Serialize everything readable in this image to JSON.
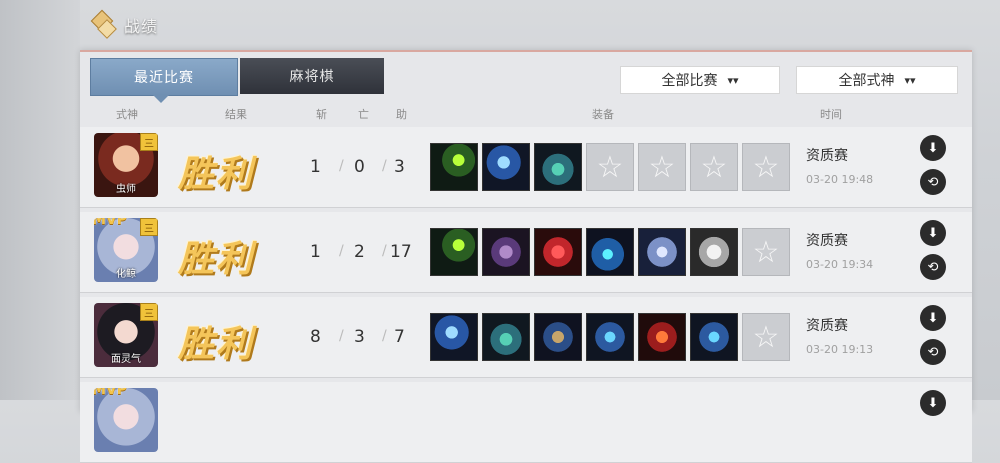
{
  "header": {
    "title": "战绩",
    "icon": "diamond-logo-icon"
  },
  "tabs": [
    {
      "label": "最近比赛",
      "active": true
    },
    {
      "label": "麻将棋",
      "active": false
    }
  ],
  "filters": [
    {
      "label": "全部比赛",
      "icon": "double-chevron-down-icon"
    },
    {
      "label": "全部式神",
      "icon": "double-chevron-down-icon"
    }
  ],
  "columns": {
    "shikigami": "式神",
    "result": "结果",
    "kill": "斩",
    "death": "亡",
    "assist": "助",
    "equipment": "装备",
    "time": "时间"
  },
  "rows": [
    {
      "avatar_name": "虫师",
      "mvp": "",
      "grade": "三",
      "result": "胜利",
      "kill": "1",
      "death": "0",
      "assist": "3",
      "mode": "资质赛",
      "time": "03-20 19:48",
      "equipment": [
        "eq-green",
        "eq-blue",
        "eq-box",
        "empty",
        "empty",
        "empty",
        "empty"
      ]
    },
    {
      "avatar_name": "化鲸",
      "mvp": "MVP",
      "grade": "三",
      "result": "胜利",
      "kill": "1",
      "death": "2",
      "assist": "17",
      "mode": "资质赛",
      "time": "03-20 19:34",
      "equipment": [
        "eq-green",
        "eq-boot",
        "eq-red",
        "eq-cyan",
        "eq-mask",
        "eq-robe",
        "empty"
      ]
    },
    {
      "avatar_name": "面灵气",
      "mvp": "",
      "grade": "三",
      "result": "胜利",
      "kill": "8",
      "death": "3",
      "assist": "7",
      "mode": "资质赛",
      "time": "03-20 19:13",
      "equipment": [
        "eq-blue",
        "eq-box",
        "eq-wheel",
        "eq-orb",
        "eq-bomb",
        "eq-orb",
        "empty"
      ]
    }
  ],
  "partial_row": {
    "mvp": "MVP"
  },
  "icons": {
    "download": "download-icon",
    "replay": "replay-icon",
    "empty_slot": "star-icon"
  }
}
